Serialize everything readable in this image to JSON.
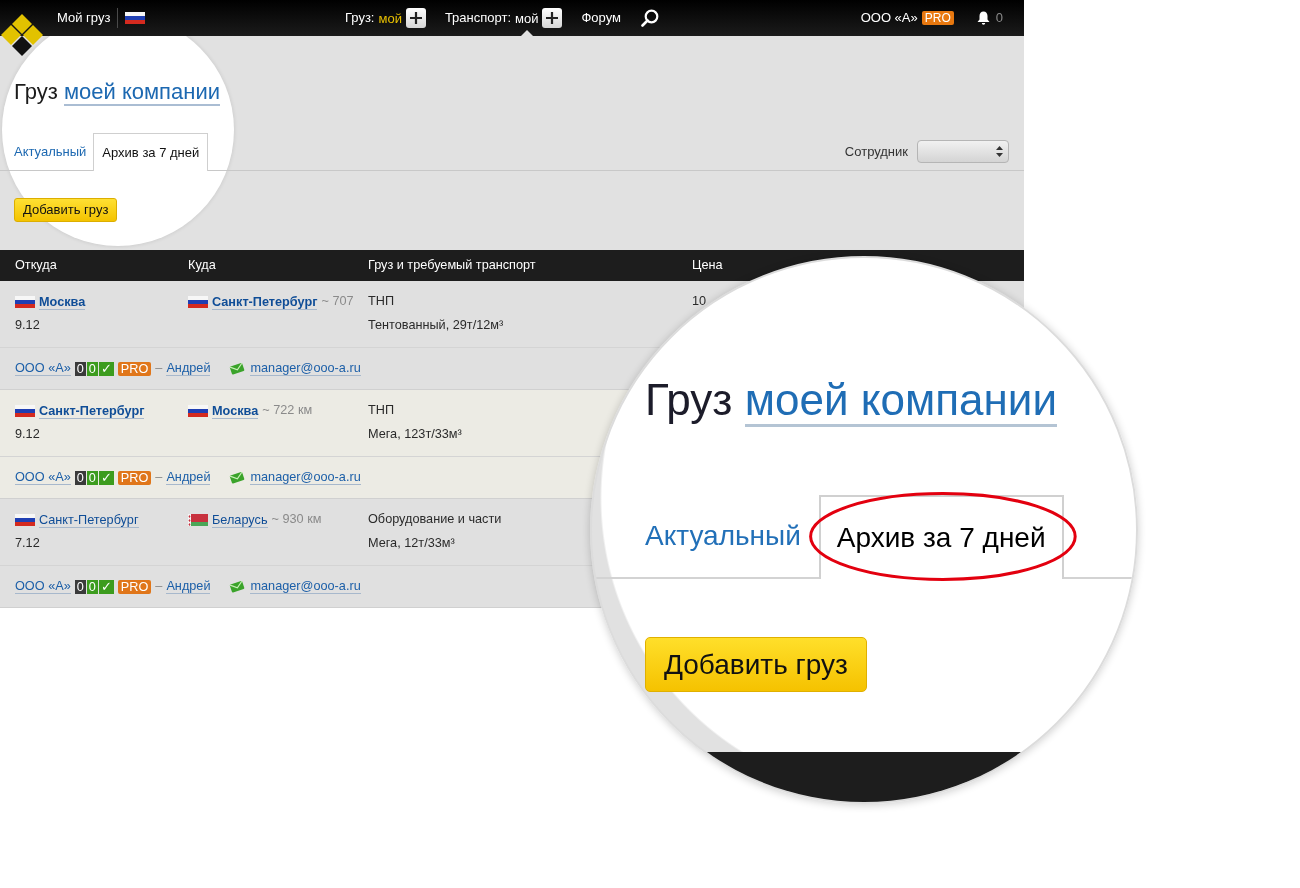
{
  "navbar": {
    "brand": "Мой груз",
    "flag": {
      "kind": "ru"
    },
    "menu": [
      {
        "label": "Груз:",
        "value": "мой",
        "highlighted": true,
        "selected": false
      },
      {
        "label": "Транспорт:",
        "value": "мой",
        "highlighted": false,
        "selected": true
      }
    ],
    "forum": "Форум",
    "company": "ООО «А»",
    "company_badge": "PRO",
    "notifications": "0"
  },
  "header": {
    "title": "Груз",
    "title_link": "моей компании",
    "tabs": [
      {
        "label": "Актуальный",
        "selected": false
      },
      {
        "label": "Архив за 7 дней",
        "selected": true
      }
    ],
    "employee_label": "Сотрудник",
    "add_button": "Добавить груз"
  },
  "table": {
    "columns": [
      "Откуда",
      "Куда",
      "Груз и требуемый транспорт",
      "Цена"
    ],
    "rows": [
      {
        "highlighted": false,
        "emphasized": true,
        "from": {
          "flag": {
            "kind": "ru"
          },
          "city": "Москва"
        },
        "date": "9.12",
        "to": {
          "flag": {
            "kind": "ru"
          },
          "city": "Санкт-Петербург",
          "distance": "~ 707"
        },
        "cargo": "ТНП",
        "transport": "Тентованный, 29т/12м³",
        "price": "10",
        "contact": {
          "company": "ООО «А»",
          "counters": [
            {
              "text": "0",
              "color": "#3a3a3a"
            },
            {
              "text": "0",
              "color": "#3c9c1e"
            },
            {
              "text": "✓",
              "color": "#3c9c1e"
            }
          ],
          "badge": "PRO",
          "separator": "–",
          "person": "Андрей",
          "email": "manager@ooo-a.ru"
        }
      },
      {
        "highlighted": true,
        "emphasized": true,
        "from": {
          "flag": {
            "kind": "ru"
          },
          "city": "Санкт-Петербург"
        },
        "date": "9.12",
        "to": {
          "flag": {
            "kind": "ru"
          },
          "city": "Москва",
          "distance": "~ 722 км"
        },
        "cargo": "ТНП",
        "transport": "Мега, 123т/33м³",
        "contact": {
          "company": "ООО «А»",
          "counters": [
            {
              "text": "0",
              "color": "#3a3a3a"
            },
            {
              "text": "0",
              "color": "#3c9c1e"
            },
            {
              "text": "✓",
              "color": "#3c9c1e"
            }
          ],
          "badge": "PRO",
          "separator": "–",
          "person": "Андрей",
          "email": "manager@ooo-a.ru"
        }
      },
      {
        "highlighted": false,
        "emphasized": false,
        "from": {
          "flag": {
            "kind": "ru"
          },
          "city": "Санкт-Петербург"
        },
        "date": "7.12",
        "to": {
          "flag": {
            "kind": "by"
          },
          "city": "Беларусь",
          "distance": "~ 930 км"
        },
        "cargo": "Оборудование и части",
        "transport": "Мега, 12т/33м³",
        "contact": {
          "company": "ООО «А»",
          "counters": [
            {
              "text": "0",
              "color": "#3a3a3a"
            },
            {
              "text": "0",
              "color": "#3c9c1e"
            },
            {
              "text": "✓",
              "color": "#3c9c1e"
            }
          ],
          "badge": "PRO",
          "separator": "–",
          "person": "Андрей",
          "email": "manager@ooo-a.ru"
        }
      }
    ]
  },
  "magnifier": {
    "title": "Груз",
    "title_link": "моей компании",
    "tabs": [
      {
        "label": "Актуальный",
        "selected": false,
        "circled": false
      },
      {
        "label": "Архив за 7 дней",
        "selected": true,
        "circled": true
      }
    ],
    "add_button": "Добавить груз"
  }
}
